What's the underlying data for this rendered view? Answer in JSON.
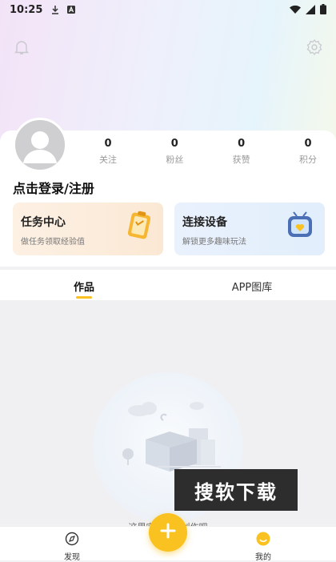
{
  "status_bar": {
    "time": "10:25"
  },
  "profile": {
    "login_label": "点击登录/注册",
    "stats": [
      {
        "value": "0",
        "label": "关注"
      },
      {
        "value": "0",
        "label": "粉丝"
      },
      {
        "value": "0",
        "label": "获赞"
      },
      {
        "value": "0",
        "label": "积分"
      }
    ]
  },
  "cards": {
    "task": {
      "title": "任务中心",
      "subtitle": "做任务领取经验值"
    },
    "device": {
      "title": "连接设备",
      "subtitle": "解锁更多趣味玩法"
    }
  },
  "tabs": [
    {
      "label": "作品",
      "active": true
    },
    {
      "label": "APP图库",
      "active": false
    }
  ],
  "empty_state": {
    "text": "这里空空，去创作吧"
  },
  "watermark": "搜软下载",
  "bottom_nav": {
    "discover": "发现",
    "mine": "我的"
  },
  "colors": {
    "accent": "#f9c220"
  },
  "icons": {
    "bell": "bell-icon",
    "settings": "gear-icon",
    "discover": "compass-icon",
    "mine": "smile-icon",
    "fab": "plus-icon"
  }
}
